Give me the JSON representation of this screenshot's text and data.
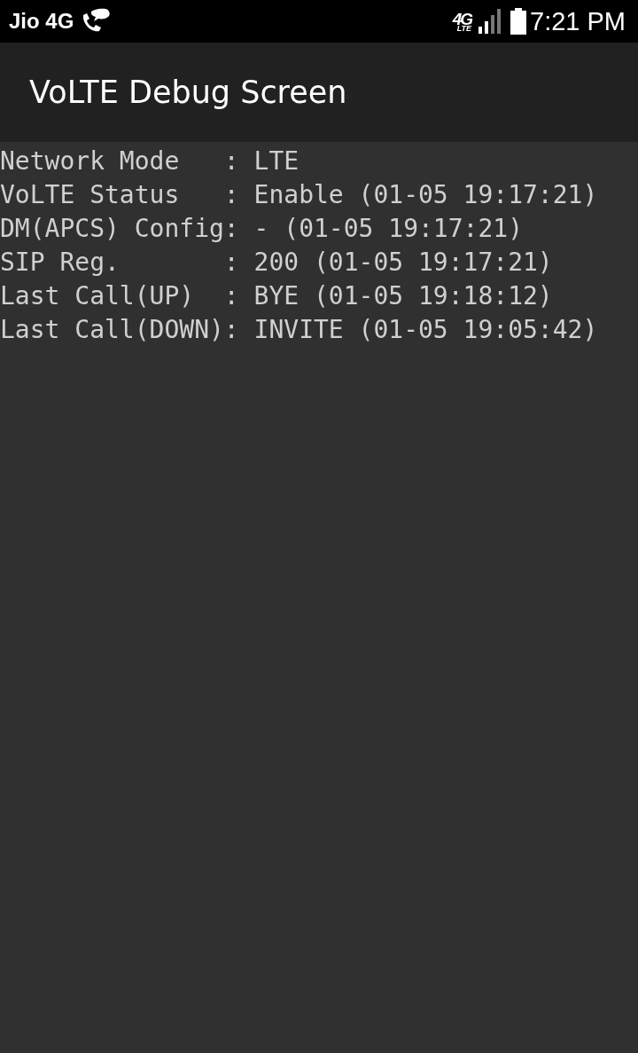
{
  "status_bar": {
    "carrier": "Jio 4G",
    "network_type": "4G",
    "network_subtype": "LTE",
    "time": "7:21 PM"
  },
  "app_bar": {
    "title": "VoLTE Debug Screen"
  },
  "lines": [
    "Network Mode   : LTE",
    "VoLTE Status   : Enable (01-05 19:17:21)",
    "DM(APCS) Config: - (01-05 19:17:21)",
    "SIP Reg.       : 200 (01-05 19:17:21)",
    "Last Call(UP)  : BYE (01-05 19:18:12)",
    "Last Call(DOWN): INVITE (01-05 19:05:42)"
  ]
}
